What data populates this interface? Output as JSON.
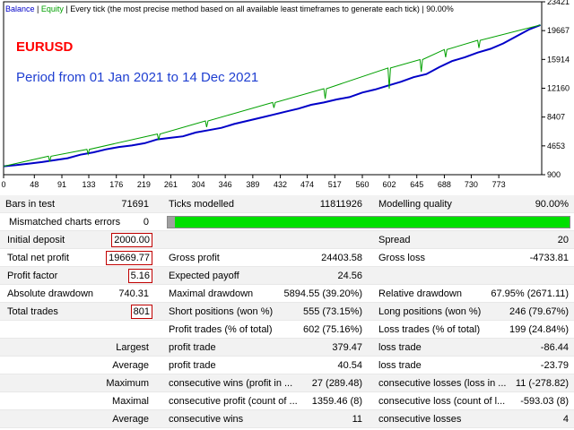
{
  "legend": {
    "balance": "Balance",
    "sep1": " | ",
    "equity": "Equity",
    "text": " | Every tick (the most precise method based on all available least timeframes to generate each tick) | 90.00%"
  },
  "chart_overlay": {
    "symbol": "EURUSD",
    "period": "Period from 01 Jan 2021 to 14 Dec 2021"
  },
  "chart_data": {
    "type": "line",
    "x_ticks": [
      "0",
      "48",
      "91",
      "133",
      "176",
      "219",
      "261",
      "304",
      "346",
      "389",
      "432",
      "474",
      "517",
      "560",
      "602",
      "645",
      "688",
      "730",
      "773"
    ],
    "x_range": [
      0,
      840
    ],
    "y_ticks": [
      "900",
      "4653",
      "8407",
      "12160",
      "15914",
      "19667",
      "23421"
    ],
    "y_range": [
      900,
      23421
    ],
    "series": [
      {
        "name": "Balance",
        "color": "#0000c8",
        "x": [
          0,
          20,
          40,
          60,
          80,
          100,
          120,
          140,
          160,
          180,
          200,
          220,
          240,
          260,
          280,
          300,
          320,
          340,
          360,
          380,
          400,
          420,
          440,
          460,
          480,
          500,
          520,
          540,
          560,
          580,
          600,
          620,
          640,
          660,
          680,
          700,
          720,
          740,
          760,
          780,
          800,
          820,
          838
        ],
        "y": [
          2000,
          2150,
          2350,
          2550,
          2800,
          3050,
          3500,
          3800,
          4200,
          4500,
          4700,
          5000,
          5500,
          5700,
          5900,
          6400,
          6700,
          7000,
          7500,
          7900,
          8300,
          8700,
          9100,
          9500,
          10000,
          10300,
          10700,
          11000,
          11600,
          12000,
          12500,
          13000,
          13600,
          14000,
          14900,
          15700,
          16200,
          16800,
          17300,
          18000,
          18900,
          19800,
          20400
        ]
      },
      {
        "name": "Equity",
        "color": "#00a000",
        "x": [
          0,
          70,
          72,
          74,
          130,
          132,
          134,
          240,
          242,
          244,
          315,
          317,
          319,
          420,
          422,
          424,
          500,
          502,
          504,
          600,
          602,
          604,
          650,
          652,
          654,
          688,
          690,
          692,
          740,
          742,
          744,
          838
        ],
        "y": [
          2000,
          3300,
          2600,
          3300,
          4200,
          3600,
          4200,
          6200,
          5400,
          6200,
          7900,
          7100,
          7900,
          10300,
          9600,
          10300,
          12100,
          10800,
          12100,
          14800,
          12100,
          14800,
          15900,
          14300,
          15900,
          17200,
          16200,
          17200,
          18400,
          17400,
          18400,
          20400
        ]
      }
    ],
    "grid": true,
    "axis_position": "right"
  },
  "report": {
    "r1": {
      "a": "Bars in test",
      "b": "71691",
      "c": "Ticks modelled",
      "d": "11811926",
      "e": "Modelling quality",
      "f": "90.00%"
    },
    "r2": {
      "a": "Mismatched charts errors",
      "b": "0",
      "quality": 0.9
    },
    "r3": {
      "a": "Initial deposit",
      "b": "2000.00",
      "e": "Spread",
      "f": "20"
    },
    "r4": {
      "a": "Total net profit",
      "b": "19669.77",
      "c": "Gross profit",
      "d": "24403.58",
      "e": "Gross loss",
      "f": "-4733.81"
    },
    "r5": {
      "a": "Profit factor",
      "b": "5.16",
      "c": "Expected payoff",
      "d": "24.56"
    },
    "r6": {
      "a": "Absolute drawdown",
      "b": "740.31",
      "c": "Maximal drawdown",
      "d": "5894.55 (39.20%)",
      "e": "Relative drawdown",
      "f": "67.95% (2671.11)"
    },
    "r7": {
      "a": "Total trades",
      "b": "801",
      "c": "Short positions (won %)",
      "d": "555 (73.15%)",
      "e": "Long positions (won %)",
      "f": "246 (79.67%)"
    },
    "r8": {
      "c": "Profit trades (% of total)",
      "d": "602 (75.16%)",
      "e": "Loss trades (% of total)",
      "f": "199 (24.84%)"
    },
    "r9": {
      "a": "Largest",
      "c": "profit trade",
      "d": "379.47",
      "e": "loss trade",
      "f": "-86.44"
    },
    "r10": {
      "a": "Average",
      "c": "profit trade",
      "d": "40.54",
      "e": "loss trade",
      "f": "-23.79"
    },
    "r11": {
      "a": "Maximum",
      "c": "consecutive wins (profit in ...",
      "d": "27 (289.48)",
      "e": "consecutive losses (loss in ...",
      "f": "11 (-278.82)"
    },
    "r12": {
      "a": "Maximal",
      "c": "consecutive profit (count of ...",
      "d": "1359.46 (8)",
      "e": "consecutive loss (count of l...",
      "f": "-593.03 (8)"
    },
    "r13": {
      "a": "Average",
      "c": "consecutive wins",
      "d": "11",
      "e": "consecutive losses",
      "f": "4"
    }
  }
}
